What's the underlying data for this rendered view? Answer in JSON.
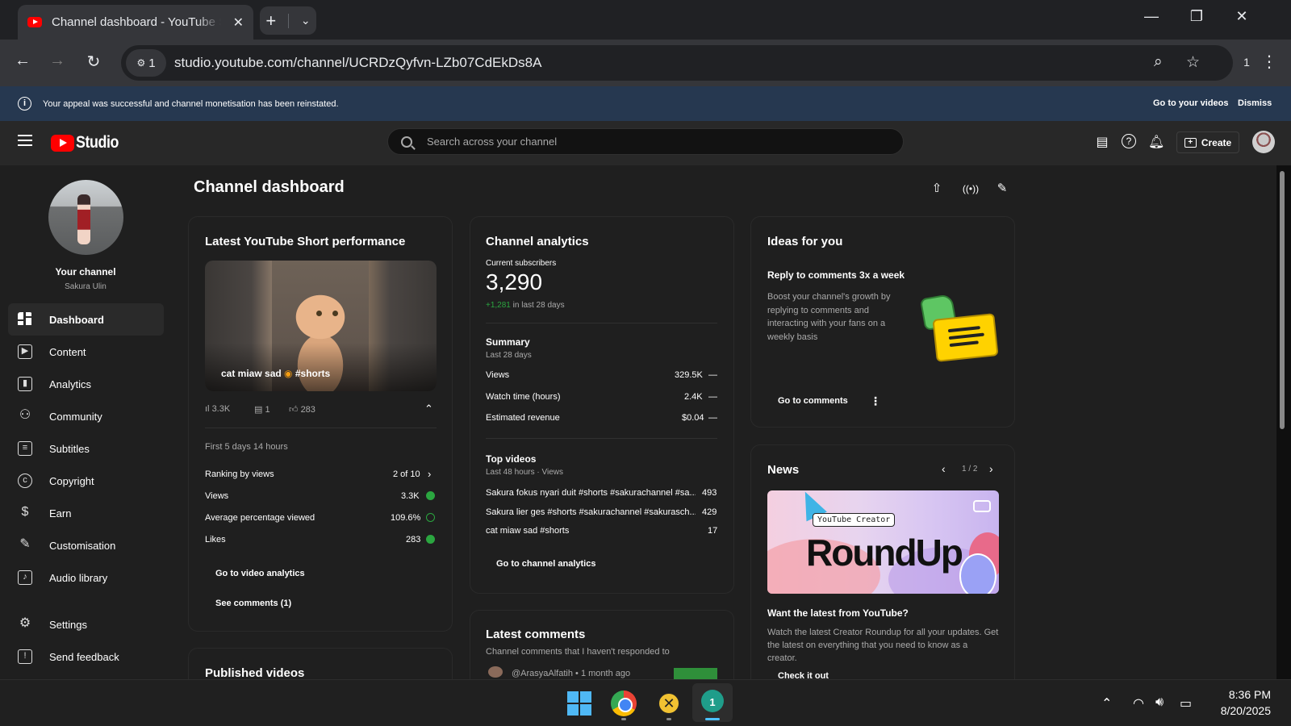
{
  "browser": {
    "tab_title": "Channel dashboard - YouTube Studio",
    "url": "studio.youtube.com/channel/UCRDzQyfvn-LZb07CdEkDs8A",
    "site_badge": "1",
    "profile_count": "1"
  },
  "banner": {
    "message": "Your appeal was successful and channel monetisation has been reinstated.",
    "go_to_videos": "Go to your videos",
    "dismiss": "Dismiss"
  },
  "header": {
    "logo_text": "Studio",
    "search_placeholder": "Search across your channel",
    "create_label": "Create"
  },
  "sidebar": {
    "channel_name": "Your channel",
    "channel_handle": "Sakura Ulin",
    "items": [
      {
        "label": "Dashboard",
        "icon": "dashboard-icon"
      },
      {
        "label": "Content",
        "icon": "content-icon"
      },
      {
        "label": "Analytics",
        "icon": "analytics-icon"
      },
      {
        "label": "Community",
        "icon": "community-icon"
      },
      {
        "label": "Subtitles",
        "icon": "subtitles-icon"
      },
      {
        "label": "Copyright",
        "icon": "copyright-icon"
      },
      {
        "label": "Earn",
        "icon": "earn-icon"
      },
      {
        "label": "Customisation",
        "icon": "customisation-icon"
      },
      {
        "label": "Audio library",
        "icon": "audio-library-icon"
      },
      {
        "label": "Settings",
        "icon": "settings-icon"
      },
      {
        "label": "Send feedback",
        "icon": "feedback-icon"
      }
    ]
  },
  "main": {
    "page_title": "Channel dashboard"
  },
  "short_card": {
    "title": "Latest YouTube Short performance",
    "video_caption": "cat miaw sad",
    "video_tag": "#shorts",
    "views_stat": "3.3K",
    "comments_stat": "1",
    "likes_stat": "283",
    "period": "First 5 days 14 hours",
    "rows": [
      {
        "label": "Ranking by views",
        "value": "2 of 10"
      },
      {
        "label": "Views",
        "value": "3.3K"
      },
      {
        "label": "Average percentage viewed",
        "value": "109.6%"
      },
      {
        "label": "Likes",
        "value": "283"
      }
    ],
    "go_analytics": "Go to video analytics",
    "see_comments": "See comments (1)"
  },
  "published_card": {
    "title": "Published videos"
  },
  "analytics_card": {
    "title": "Channel analytics",
    "subs_label": "Current subscribers",
    "subs_value": "3,290",
    "subs_delta": "+1,281",
    "subs_delta_suffix": "in last 28 days",
    "summary_title": "Summary",
    "summary_period": "Last 28 days",
    "summary_rows": [
      {
        "label": "Views",
        "value": "329.5K",
        "trend": "—"
      },
      {
        "label": "Watch time (hours)",
        "value": "2.4K",
        "trend": "—"
      },
      {
        "label": "Estimated revenue",
        "value": "$0.04",
        "trend": "—"
      }
    ],
    "top_title": "Top videos",
    "top_period": "Last 48 hours · Views",
    "top_videos": [
      {
        "title": "Sakura fokus nyari duit #shorts #sakurachannel #sa...",
        "views": "493"
      },
      {
        "title": "Sakura lier ges #shorts #sakurachannel #sakurasch...",
        "views": "429"
      },
      {
        "title": "cat miaw sad  #shorts",
        "views": "17"
      }
    ],
    "go_channel_analytics": "Go to channel analytics"
  },
  "comments_card": {
    "title": "Latest comments",
    "subtitle": "Channel comments that I haven't responded to",
    "first_author": "@ArasyaAlfatih",
    "first_time": "• 1 month ago"
  },
  "ideas_card": {
    "title": "Ideas for you",
    "heading": "Reply to comments 3x a week",
    "body": "Boost your channel's growth by replying to comments and interacting with your fans on a weekly basis",
    "cta": "Go to comments"
  },
  "news_card": {
    "title": "News",
    "pager": "1 / 2",
    "image_label": "YouTube Creator",
    "image_title": "RoundUp",
    "heading": "Want the latest from YouTube?",
    "body": "Watch the latest Creator Roundup for all your updates. Get the latest on everything that you need to know as a creator.",
    "cta": "Check it out"
  },
  "taskbar": {
    "time": "8:36 PM",
    "date": "8/20/2025",
    "app4_badge": "1"
  },
  "colors": {
    "accent_red": "#ff0000",
    "success_green": "#2ba640",
    "banner_bg": "#263850"
  }
}
